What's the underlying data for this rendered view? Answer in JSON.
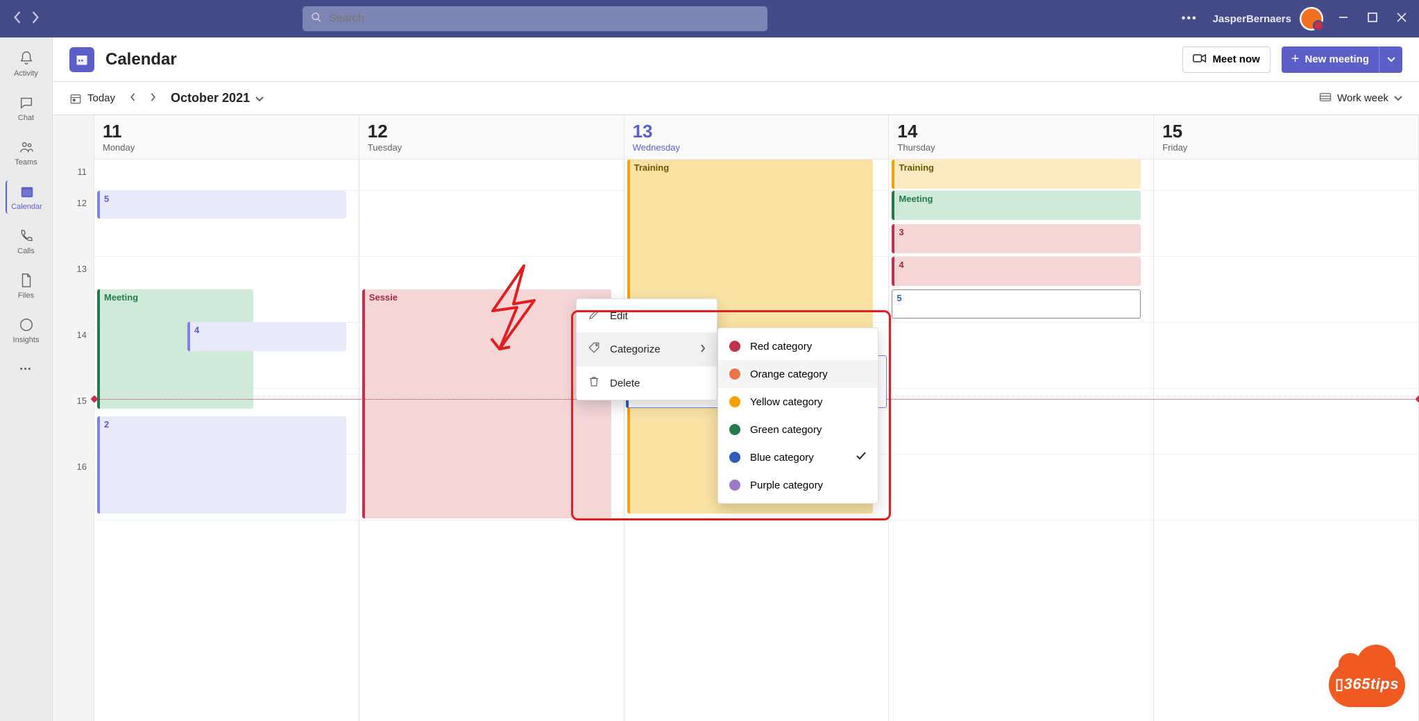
{
  "titlebar": {
    "search_placeholder": "Search",
    "username": "JasperBernaers"
  },
  "rail": {
    "items": [
      {
        "label": "Activity",
        "icon": "bell"
      },
      {
        "label": "Chat",
        "icon": "chat"
      },
      {
        "label": "Teams",
        "icon": "teams"
      },
      {
        "label": "Calendar",
        "icon": "calendar",
        "active": true
      },
      {
        "label": "Calls",
        "icon": "phone"
      },
      {
        "label": "Files",
        "icon": "file"
      },
      {
        "label": "Insights",
        "icon": "insights"
      }
    ]
  },
  "header": {
    "title": "Calendar",
    "meet_now": "Meet now",
    "new_meeting": "New meeting"
  },
  "toolbar": {
    "today": "Today",
    "month": "October 2021",
    "view": "Work week"
  },
  "calendar": {
    "time_labels": [
      "11",
      "12",
      "13",
      "14",
      "15",
      "16"
    ],
    "days": [
      {
        "num": "11",
        "name": "Monday",
        "today": false
      },
      {
        "num": "12",
        "name": "Tuesday",
        "today": false
      },
      {
        "num": "13",
        "name": "Wednesday",
        "today": true
      },
      {
        "num": "14",
        "name": "Thursday",
        "today": false
      },
      {
        "num": "15",
        "name": "Friday",
        "today": false
      }
    ],
    "events": {
      "mon_5": "5",
      "mon_meeting": "Meeting",
      "mon_4": "4",
      "mon_2": "2",
      "tue_sessie": "Sessie",
      "wed_training": "Training",
      "thu_training": "Training",
      "thu_meeting": "Meeting",
      "thu_3": "3",
      "thu_4": "4",
      "thu_5": "5"
    }
  },
  "context_menu": {
    "edit": "Edit",
    "categorize": "Categorize",
    "delete": "Delete"
  },
  "categories": [
    {
      "label": "Red category",
      "color": "#c4314b"
    },
    {
      "label": "Orange category",
      "color": "#e97548"
    },
    {
      "label": "Yellow category",
      "color": "#f2a100"
    },
    {
      "label": "Green category",
      "color": "#237b4b"
    },
    {
      "label": "Blue category",
      "color": "#2f5cb6",
      "checked": true
    },
    {
      "label": "Purple category",
      "color": "#9b7bc9"
    }
  ],
  "watermark": {
    "text": "365tips"
  }
}
